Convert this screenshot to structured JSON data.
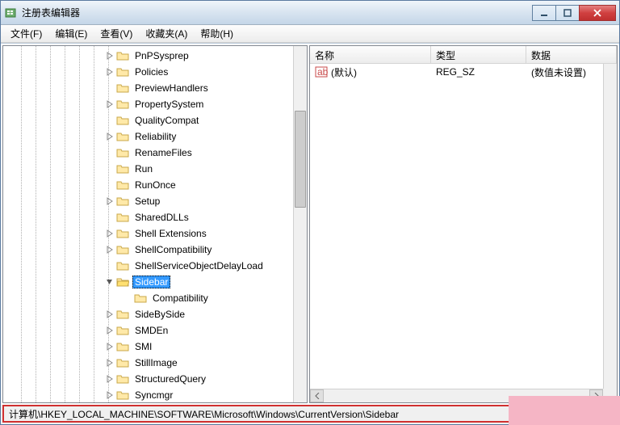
{
  "window": {
    "title": "注册表编辑器"
  },
  "menubar": {
    "file": "文件(F)",
    "edit": "编辑(E)",
    "view": "查看(V)",
    "fav": "收藏夹(A)",
    "help": "帮助(H)"
  },
  "tree": {
    "items": [
      {
        "label": "PnPSysprep",
        "expandable": true,
        "depth": 0
      },
      {
        "label": "Policies",
        "expandable": true,
        "depth": 0
      },
      {
        "label": "PreviewHandlers",
        "expandable": false,
        "depth": 0
      },
      {
        "label": "PropertySystem",
        "expandable": true,
        "depth": 0
      },
      {
        "label": "QualityCompat",
        "expandable": false,
        "depth": 0
      },
      {
        "label": "Reliability",
        "expandable": true,
        "depth": 0
      },
      {
        "label": "RenameFiles",
        "expandable": false,
        "depth": 0
      },
      {
        "label": "Run",
        "expandable": false,
        "depth": 0
      },
      {
        "label": "RunOnce",
        "expandable": false,
        "depth": 0
      },
      {
        "label": "Setup",
        "expandable": true,
        "depth": 0
      },
      {
        "label": "SharedDLLs",
        "expandable": false,
        "depth": 0
      },
      {
        "label": "Shell Extensions",
        "expandable": true,
        "depth": 0
      },
      {
        "label": "ShellCompatibility",
        "expandable": true,
        "depth": 0
      },
      {
        "label": "ShellServiceObjectDelayLoad",
        "expandable": false,
        "depth": 0
      },
      {
        "label": "Sidebar",
        "expandable": true,
        "depth": 0,
        "expanded": true,
        "selected": true
      },
      {
        "label": "Compatibility",
        "expandable": false,
        "depth": 1
      },
      {
        "label": "SideBySide",
        "expandable": true,
        "depth": 0
      },
      {
        "label": "SMDEn",
        "expandable": true,
        "depth": 0
      },
      {
        "label": "SMI",
        "expandable": true,
        "depth": 0
      },
      {
        "label": "StillImage",
        "expandable": true,
        "depth": 0
      },
      {
        "label": "StructuredQuery",
        "expandable": true,
        "depth": 0
      },
      {
        "label": "Syncmgr",
        "expandable": true,
        "depth": 0
      }
    ]
  },
  "list": {
    "columns": {
      "name": "名称",
      "type": "类型",
      "data": "数据"
    },
    "rows": [
      {
        "name": "(默认)",
        "type": "REG_SZ",
        "data": "(数值未设置)"
      }
    ]
  },
  "statusbar": {
    "path": "计算机\\HKEY_LOCAL_MACHINE\\SOFTWARE\\Microsoft\\Windows\\CurrentVersion\\Sidebar"
  }
}
